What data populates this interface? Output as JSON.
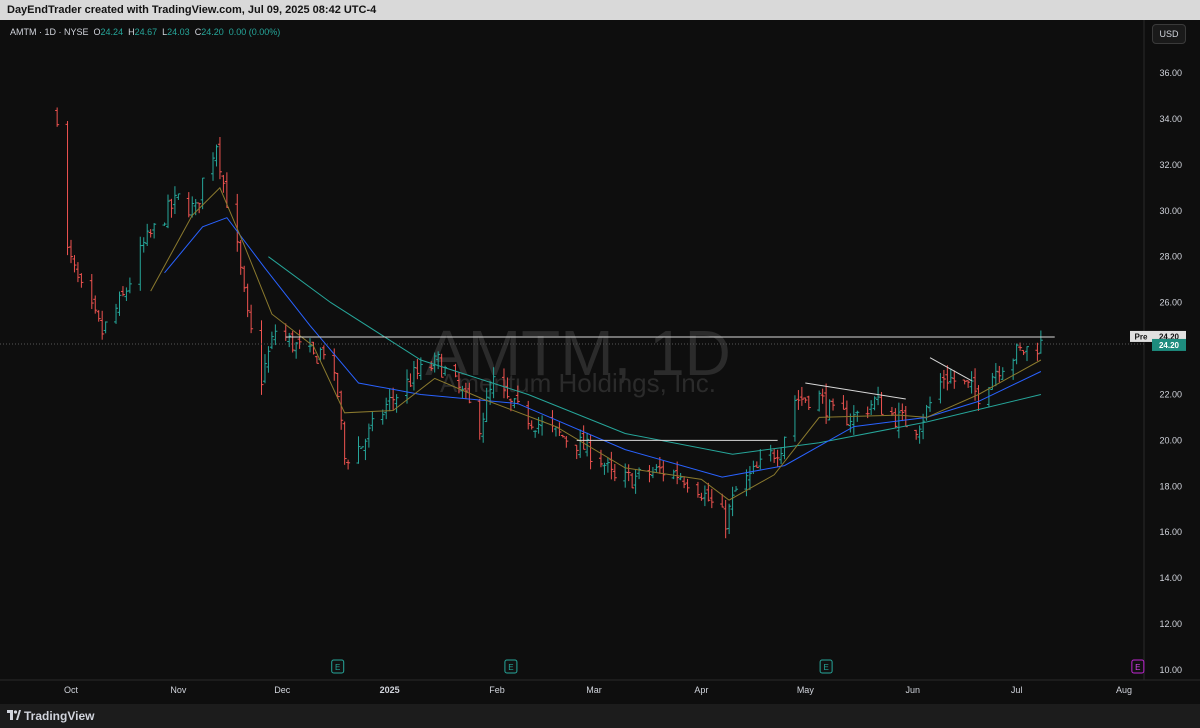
{
  "header": {
    "attribution": "DayEndTrader created with TradingView.com, Jul 09, 2025 08:42 UTC-4"
  },
  "legend": {
    "symbol": "AMTM · 1D · NYSE",
    "open_label": "O",
    "open_value": "24.24",
    "high_label": "H",
    "high_value": "24.67",
    "low_label": "L",
    "low_value": "24.03",
    "close_label": "C",
    "close_value": "24.20",
    "change": "0.00 (0.00%)"
  },
  "currency_button": "USD",
  "watermark": {
    "ticker": "AMTM, 1D",
    "company": "Amentum Holdings, Inc."
  },
  "footer": {
    "brand": "TradingView"
  },
  "price_tags": {
    "pre_label": "Pre",
    "pre_value": "24.20",
    "last_value": "24.20"
  },
  "earnings_marker": "E",
  "colors": {
    "up": "#26a69a",
    "down": "#ef5350",
    "ema_fast": "#8b7a2e",
    "ema_mid": "#2962ff",
    "ema_slow": "#26a69a",
    "background": "#0e0e0e"
  },
  "chart_data": {
    "type": "ohlc",
    "y_axis_ticks": [
      "36.00",
      "34.00",
      "32.00",
      "30.00",
      "28.00",
      "26.00",
      "22.00",
      "20.00",
      "18.00",
      "16.00",
      "14.00",
      "12.00",
      "10.00"
    ],
    "ylim": [
      10,
      37
    ],
    "x_axis_labels": [
      {
        "label": "Oct",
        "date": "2024-10-01"
      },
      {
        "label": "Nov",
        "date": "2024-11-01"
      },
      {
        "label": "Dec",
        "date": "2024-12-01"
      },
      {
        "label": "2025",
        "date": "2025-01-01"
      },
      {
        "label": "Feb",
        "date": "2025-02-01"
      },
      {
        "label": "Mar",
        "date": "2025-03-01"
      },
      {
        "label": "Apr",
        "date": "2025-04-01"
      },
      {
        "label": "May",
        "date": "2025-05-01"
      },
      {
        "label": "Jun",
        "date": "2025-06-01"
      },
      {
        "label": "Jul",
        "date": "2025-07-01"
      },
      {
        "label": "Aug",
        "date": "2025-08-01"
      }
    ],
    "price_path": [
      [
        "2024-09-27",
        34.2
      ],
      [
        "2024-09-30",
        28.2
      ],
      [
        "2024-10-04",
        26.5
      ],
      [
        "2024-10-10",
        24.7
      ],
      [
        "2024-10-16",
        26.2
      ],
      [
        "2024-10-22",
        28.5
      ],
      [
        "2024-10-28",
        29.8
      ],
      [
        "2024-11-01",
        30.5
      ],
      [
        "2024-11-06",
        30.0
      ],
      [
        "2024-11-08",
        31.3
      ],
      [
        "2024-11-12",
        33.0
      ],
      [
        "2024-11-14",
        31.2
      ],
      [
        "2024-11-18",
        28.3
      ],
      [
        "2024-11-21",
        25.3
      ],
      [
        "2024-11-25",
        22.7
      ],
      [
        "2024-11-29",
        24.8
      ],
      [
        "2024-12-04",
        24.2
      ],
      [
        "2024-12-10",
        23.6
      ],
      [
        "2024-12-13",
        24.0
      ],
      [
        "2024-12-17",
        22.0
      ],
      [
        "2024-12-19",
        19.2
      ],
      [
        "2024-12-24",
        19.8
      ],
      [
        "2024-12-31",
        21.5
      ],
      [
        "2025-01-08",
        22.8
      ],
      [
        "2025-01-15",
        23.4
      ],
      [
        "2025-01-22",
        22.0
      ],
      [
        "2025-01-27",
        20.7
      ],
      [
        "2025-01-31",
        22.5
      ],
      [
        "2025-02-05",
        21.5
      ],
      [
        "2025-02-12",
        20.8
      ],
      [
        "2025-02-18",
        20.3
      ],
      [
        "2025-02-24",
        19.9
      ],
      [
        "2025-03-03",
        19.2
      ],
      [
        "2025-03-07",
        18.2
      ],
      [
        "2025-03-14",
        18.4
      ],
      [
        "2025-03-20",
        18.7
      ],
      [
        "2025-03-26",
        18.5
      ],
      [
        "2025-03-31",
        18.0
      ],
      [
        "2025-04-04",
        17.2
      ],
      [
        "2025-04-08",
        16.5
      ],
      [
        "2025-04-11",
        17.8
      ],
      [
        "2025-04-17",
        18.7
      ],
      [
        "2025-04-24",
        19.8
      ],
      [
        "2025-04-28",
        21.8
      ],
      [
        "2025-05-05",
        21.9
      ],
      [
        "2025-05-09",
        21.1
      ],
      [
        "2025-05-15",
        21.0
      ],
      [
        "2025-05-21",
        21.7
      ],
      [
        "2025-05-27",
        21.0
      ],
      [
        "2025-06-02",
        20.6
      ],
      [
        "2025-06-05",
        21.3
      ],
      [
        "2025-06-10",
        22.8
      ],
      [
        "2025-06-16",
        22.4
      ],
      [
        "2025-06-20",
        22.0
      ],
      [
        "2025-06-25",
        23.1
      ],
      [
        "2025-07-01",
        23.8
      ],
      [
        "2025-07-08",
        24.2
      ]
    ],
    "ema_fast_path": [
      [
        "2024-10-24",
        26.5
      ],
      [
        "2024-11-05",
        29.8
      ],
      [
        "2024-11-13",
        31.0
      ],
      [
        "2024-11-20",
        28.5
      ],
      [
        "2024-11-28",
        25.5
      ],
      [
        "2024-12-10",
        24.1
      ],
      [
        "2024-12-19",
        21.2
      ],
      [
        "2025-01-02",
        21.3
      ],
      [
        "2025-01-14",
        22.7
      ],
      [
        "2025-01-28",
        21.8
      ],
      [
        "2025-02-18",
        20.6
      ],
      [
        "2025-03-10",
        18.8
      ],
      [
        "2025-04-01",
        18.3
      ],
      [
        "2025-04-09",
        17.4
      ],
      [
        "2025-04-22",
        18.5
      ],
      [
        "2025-05-05",
        21.0
      ],
      [
        "2025-05-28",
        21.1
      ],
      [
        "2025-06-05",
        21.0
      ],
      [
        "2025-06-20",
        22.0
      ],
      [
        "2025-07-08",
        23.5
      ]
    ],
    "ema_mid_path": [
      [
        "2024-10-28",
        27.3
      ],
      [
        "2024-11-08",
        29.3
      ],
      [
        "2024-11-15",
        29.7
      ],
      [
        "2024-11-26",
        27.5
      ],
      [
        "2024-12-09",
        25.0
      ],
      [
        "2024-12-23",
        22.5
      ],
      [
        "2025-01-10",
        22.0
      ],
      [
        "2025-02-07",
        21.6
      ],
      [
        "2025-03-10",
        19.6
      ],
      [
        "2025-04-07",
        18.4
      ],
      [
        "2025-04-25",
        18.9
      ],
      [
        "2025-05-15",
        20.6
      ],
      [
        "2025-06-05",
        21.0
      ],
      [
        "2025-06-20",
        21.7
      ],
      [
        "2025-07-08",
        23.0
      ]
    ],
    "ema_slow_path": [
      [
        "2024-11-27",
        28.0
      ],
      [
        "2024-12-15",
        26.0
      ],
      [
        "2025-01-10",
        23.5
      ],
      [
        "2025-02-10",
        22.0
      ],
      [
        "2025-03-10",
        20.3
      ],
      [
        "2025-04-10",
        19.4
      ],
      [
        "2025-05-05",
        19.9
      ],
      [
        "2025-06-05",
        20.8
      ],
      [
        "2025-07-08",
        22.0
      ]
    ],
    "trendlines": [
      {
        "from": [
          "2024-12-02",
          24.5
        ],
        "to": [
          "2025-07-12",
          24.5
        ]
      },
      {
        "from": [
          "2025-02-24",
          20.0
        ],
        "to": [
          "2025-04-23",
          20.0
        ]
      },
      {
        "from": [
          "2025-05-01",
          22.5
        ],
        "to": [
          "2025-05-30",
          21.8
        ]
      },
      {
        "from": [
          "2025-06-06",
          23.6
        ],
        "to": [
          "2025-06-18",
          22.6
        ]
      }
    ],
    "earnings_dates": [
      "2024-12-17",
      "2025-02-05",
      "2025-05-07",
      "2025-08-05"
    ],
    "last_price": 24.2,
    "legend_position": "top-left"
  }
}
